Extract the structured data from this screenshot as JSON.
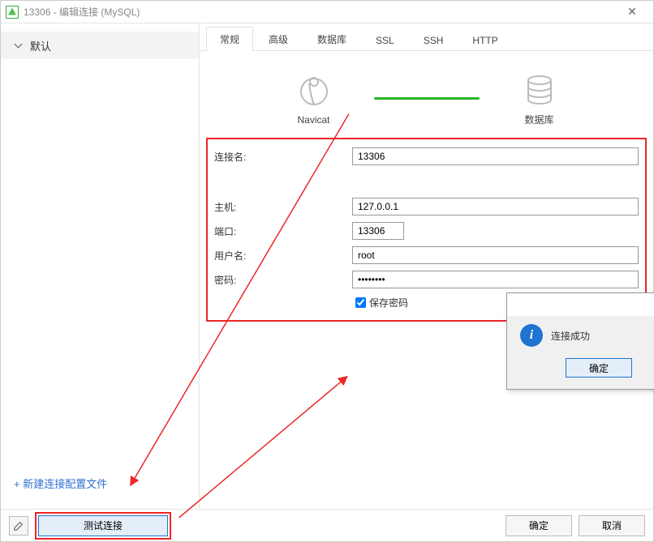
{
  "window": {
    "title": "13306 - 编辑连接 (MySQL)"
  },
  "sidebar": {
    "profile": "默认",
    "new_profile_link": "+ 新建连接配置文件"
  },
  "tabs": [
    "常规",
    "高级",
    "数据库",
    "SSL",
    "SSH",
    "HTTP"
  ],
  "diagram": {
    "left_label": "Navicat",
    "right_label": "数据库"
  },
  "form": {
    "conn_name_label": "连接名:",
    "conn_name_value": "13306",
    "host_label": "主机:",
    "host_value": "127.0.0.1",
    "port_label": "端口:",
    "port_value": "13306",
    "user_label": "用户名:",
    "user_value": "root",
    "pass_label": "密码:",
    "pass_value": "••••••••",
    "save_pass_label": "保存密码"
  },
  "dialog": {
    "message": "连接成功",
    "ok_label": "确定"
  },
  "footer": {
    "test_label": "测试连接",
    "ok_label": "确定",
    "cancel_label": "取消"
  }
}
